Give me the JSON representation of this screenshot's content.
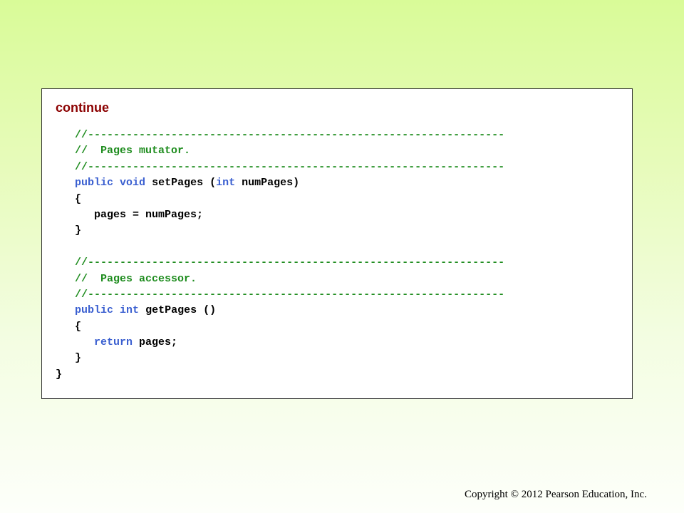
{
  "slide": {
    "continue_label": "continue",
    "copyright": "Copyright © 2012 Pearson Education, Inc."
  },
  "colors": {
    "continue_label": "#8b0000",
    "comment": "#1e8c1e",
    "keyword": "#3a5fd0",
    "plain": "#000000"
  },
  "code": {
    "lines": [
      {
        "indent": 1,
        "tokens": [
          {
            "type": "comment",
            "text": "//-----------------------------------------------------------------"
          }
        ]
      },
      {
        "indent": 1,
        "tokens": [
          {
            "type": "comment",
            "text": "//  Pages mutator."
          }
        ]
      },
      {
        "indent": 1,
        "tokens": [
          {
            "type": "comment",
            "text": "//-----------------------------------------------------------------"
          }
        ]
      },
      {
        "indent": 1,
        "tokens": [
          {
            "type": "keyword",
            "text": "public"
          },
          {
            "type": "plain",
            "text": " "
          },
          {
            "type": "keyword",
            "text": "void"
          },
          {
            "type": "plain",
            "text": " setPages ("
          },
          {
            "type": "keyword",
            "text": "int"
          },
          {
            "type": "plain",
            "text": " numPages)"
          }
        ]
      },
      {
        "indent": 1,
        "tokens": [
          {
            "type": "plain",
            "text": "{"
          }
        ]
      },
      {
        "indent": 2,
        "tokens": [
          {
            "type": "plain",
            "text": "pages = numPages;"
          }
        ]
      },
      {
        "indent": 1,
        "tokens": [
          {
            "type": "plain",
            "text": "}"
          }
        ]
      },
      {
        "indent": 0,
        "tokens": []
      },
      {
        "indent": 1,
        "tokens": [
          {
            "type": "comment",
            "text": "//-----------------------------------------------------------------"
          }
        ]
      },
      {
        "indent": 1,
        "tokens": [
          {
            "type": "comment",
            "text": "//  Pages accessor."
          }
        ]
      },
      {
        "indent": 1,
        "tokens": [
          {
            "type": "comment",
            "text": "//-----------------------------------------------------------------"
          }
        ]
      },
      {
        "indent": 1,
        "tokens": [
          {
            "type": "keyword",
            "text": "public"
          },
          {
            "type": "plain",
            "text": " "
          },
          {
            "type": "keyword",
            "text": "int"
          },
          {
            "type": "plain",
            "text": " getPages ()"
          }
        ]
      },
      {
        "indent": 1,
        "tokens": [
          {
            "type": "plain",
            "text": "{"
          }
        ]
      },
      {
        "indent": 2,
        "tokens": [
          {
            "type": "keyword",
            "text": "return"
          },
          {
            "type": "plain",
            "text": " pages;"
          }
        ]
      },
      {
        "indent": 1,
        "tokens": [
          {
            "type": "plain",
            "text": "}"
          }
        ]
      },
      {
        "indent": 0,
        "tokens": [
          {
            "type": "plain",
            "text": "}"
          }
        ]
      }
    ]
  }
}
